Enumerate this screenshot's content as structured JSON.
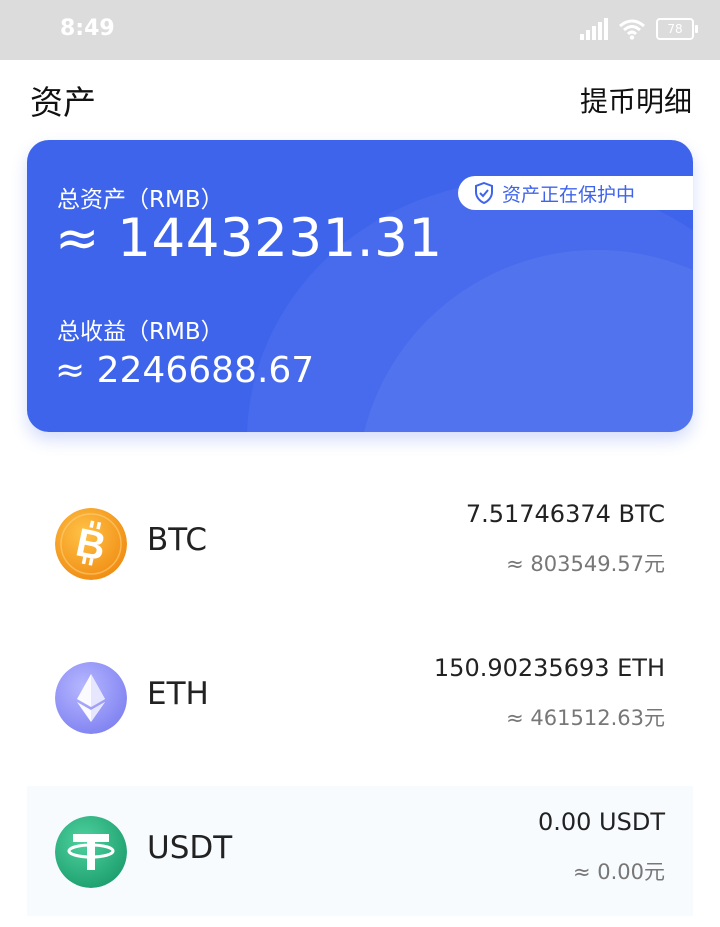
{
  "status_bar": {
    "time": "8:49",
    "battery": "78"
  },
  "header": {
    "title": "资产",
    "details_link": "提币明细"
  },
  "card": {
    "protection_badge": "资产正在保护中",
    "total_assets_label": "总资产（RMB）",
    "total_assets_value": "≈ 1443231.31",
    "total_earnings_label": "总收益（RMB）",
    "total_earnings_value": "≈ 2246688.67",
    "accent_color": "#3f64ec"
  },
  "assets": [
    {
      "symbol": "BTC",
      "amount": "7.51746374 BTC",
      "fiat": "≈ 803549.57元",
      "icon": "bitcoin-icon",
      "color": "#f7931a"
    },
    {
      "symbol": "ETH",
      "amount": "150.90235693 ETH",
      "fiat": "≈ 461512.63元",
      "icon": "ethereum-icon",
      "color": "#8c8ef5"
    },
    {
      "symbol": "USDT",
      "amount": "0.00 USDT",
      "fiat": "≈ 0.00元",
      "icon": "tether-icon",
      "color": "#26a17b"
    }
  ]
}
